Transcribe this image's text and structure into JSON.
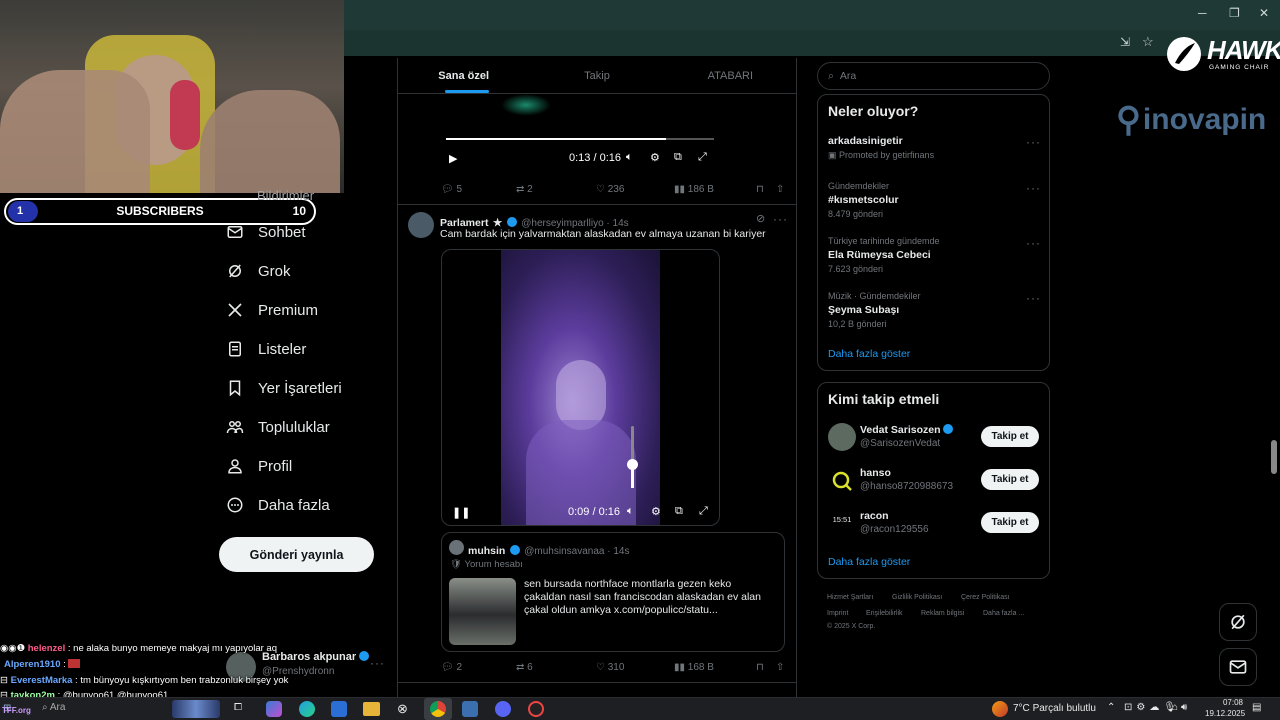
{
  "stream": {
    "subscribers_label": "SUBSCRIBERS",
    "subscribers_current": "1",
    "subscribers_goal": "10",
    "logo_brand": "HAWK",
    "logo_sub": "GAMING CHAIR",
    "sponsor": "inovapin"
  },
  "nav": {
    "partial_item": "Bildirimler",
    "items": [
      "Sohbet",
      "Grok",
      "Premium",
      "Listeler",
      "Yer İşaretleri",
      "Topluluklar",
      "Profil",
      "Daha fazla"
    ],
    "post_button": "Gönderi yayınla"
  },
  "feed": {
    "tabs": [
      "Sana özel",
      "Takip",
      "ATABARI"
    ],
    "post1": {
      "time": "0:13 / 0:16",
      "replies": "5",
      "reposts": "2",
      "likes": "236",
      "views": "186 B"
    },
    "post2": {
      "name": "Parlamert",
      "star": "★",
      "handle": "@herseyimparlliyo · 14s",
      "text": "Cam bardak için yalvarmaktan alaskadan ev almaya uzanan bi kariyer",
      "time": "0:09 / 0:16",
      "replies": "2",
      "reposts": "6",
      "likes": "310",
      "views": "168 B"
    },
    "quote": {
      "name": "muhsin",
      "handle": "@muhsinsavanaa · 14s",
      "label": "Yorum hesabı",
      "text": "sen bursada northface montlarla gezen keko çakaldan nasıl san franciscodan alaskadan ev alan çakal oldun amkya  x.com/populicc/statu..."
    }
  },
  "right": {
    "search_placeholder": "Ara",
    "trends_title": "Neler oluyor?",
    "trends": [
      {
        "sub": "",
        "title": "arkadasinigetir",
        "promo": "Promoted by getirfinans",
        "count": ""
      },
      {
        "sub": "Gündemdekiler",
        "title": "#kısmetscolur",
        "promo": "",
        "count": "8.479 gönderi"
      },
      {
        "sub": "Türkiye tarihinde gündemde",
        "title": "Ela Rümeysa Cebeci",
        "promo": "",
        "count": "7.623 gönderi"
      },
      {
        "sub": "Müzik · Gündemdekiler",
        "title": "Şeyma Subaşı",
        "promo": "",
        "count": "10,2 B gönderi"
      }
    ],
    "show_more": "Daha fazla göster",
    "follow_title": "Kimi takip etmeli",
    "follow": [
      {
        "name": "Vedat Sarisozen",
        "handle": "@SarisozenVedat",
        "button": "Takip et"
      },
      {
        "name": "hanso",
        "handle": "@hanso8720988673",
        "button": "Takip et"
      },
      {
        "name": "racon",
        "handle": "@racon129556",
        "button": "Takip et",
        "avatar_text": "15:51"
      }
    ],
    "footer": [
      "Hizmet Şartları",
      "Gizlilik Politikası",
      "Çerez Politikası",
      "Imprint",
      "Erişilebilirlik",
      "Reklam bilgisi",
      "Daha fazla ...",
      "© 2025 X Corp."
    ]
  },
  "account": {
    "name": "Barbaros akpunar",
    "handle": "@Prenshydronn"
  },
  "chat": [
    {
      "user": "helenzel",
      "msg": " : ne alaka bunyo memeye makyaj mı yapıyolar aq"
    },
    {
      "user": "Alperen1910",
      "msg": " : "
    },
    {
      "user": "EverestMarka",
      "msg": " : tm bünyoyu kışkırtıyom ben trabzonluk birşey yok"
    },
    {
      "user": "taykon2m",
      "msg": " : @bunyoo61 @bunyoo61"
    }
  ],
  "taskbar": {
    "search": "Ara",
    "weather_temp": "7°C",
    "weather_text": "Parçalı bulutlu",
    "time": "07:08",
    "date": "19.12.2025",
    "tff": "TFF.org"
  },
  "colors": {
    "accent": "#1d9bf0",
    "background": "#000000",
    "border": "#2f3336",
    "chrome": "#1f3a36"
  }
}
